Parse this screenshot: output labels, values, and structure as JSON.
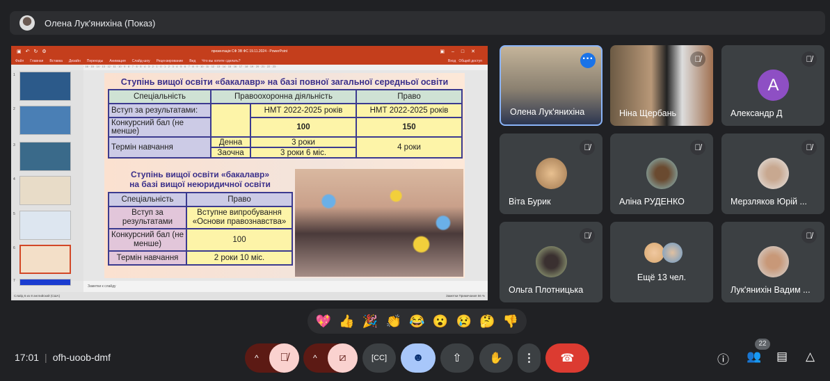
{
  "presenter_bar": {
    "name": "Олена Лук'янихіна (Показ)"
  },
  "powerpoint": {
    "title": "презентація СФ ЗВ ФС 19.11.2024 - PowerPoint",
    "ribbon_tabs": [
      "Файл",
      "Главная",
      "Вставка",
      "Дизайн",
      "Переходы",
      "Анимация",
      "Слайд-шоу",
      "Рецензирование",
      "Вид"
    ],
    "search_hint": "Что вы хотите сделать?",
    "signin": "Вход",
    "share": "Общий доступ",
    "slide_numbers": [
      "1",
      "2",
      "3",
      "4",
      "5",
      "6",
      "7"
    ],
    "notes_placeholder": "Заметки к слайду",
    "status_left": "Слайд 6 из 8   английский (США)",
    "status_right": "Заметки   Примечания   56 %"
  },
  "slide": {
    "title1": "Ступінь вищої освіти «бакалавр» на базі повної загальної середньої освіти",
    "t1": {
      "h": [
        "Спеціальність",
        "Правоохоронна діяльність",
        "Право"
      ],
      "r1": [
        "Вступ за результатами:",
        "НМТ 2022-2025 років",
        "НМТ 2022-2025 років"
      ],
      "r2": [
        "Конкурсний бал (не менше)",
        "100",
        "150"
      ],
      "r3": [
        "Термін навчання",
        "Денна",
        "3 роки",
        "4 роки"
      ],
      "r4": [
        "Заочна",
        "3 роки 6 міс."
      ]
    },
    "title2a": "Ступінь вищої освіти «бакалавр»",
    "title2b": "на базі вищої неюридичної освіти",
    "t2": {
      "h": [
        "Спеціальність",
        "Право"
      ],
      "r1": [
        "Вступ за результатами",
        "Вступне випробування «Основи правознавства»"
      ],
      "r2": [
        "Конкурсний бал (не менше)",
        "100"
      ],
      "r3": [
        "Термін навчання",
        "2 роки 10 міс."
      ]
    }
  },
  "participants": [
    {
      "name": "Олена Лук'янихіна"
    },
    {
      "name": "Ніна Щербань"
    },
    {
      "name": "Александр Д",
      "initial": "A"
    },
    {
      "name": "Віта Бурик"
    },
    {
      "name": "Аліна РУДЕНКО"
    },
    {
      "name": "Мерзляков Юрій ..."
    },
    {
      "name": "Ольга Плотницька"
    },
    {
      "name": "Ещё 13 чел."
    },
    {
      "name": "Лук'янихін Вадим ..."
    }
  ],
  "reactions": [
    "💖",
    "👍",
    "🎉",
    "👏",
    "😂",
    "😮",
    "😢",
    "🤔",
    "👎"
  ],
  "footer": {
    "time": "17:01",
    "meeting_code": "ofh-uoob-dmf",
    "people_count": "22"
  },
  "colors": {
    "end_call": "#dc3b31",
    "muted_bg": "#fad2cf",
    "accent": "#8ab4f8"
  }
}
